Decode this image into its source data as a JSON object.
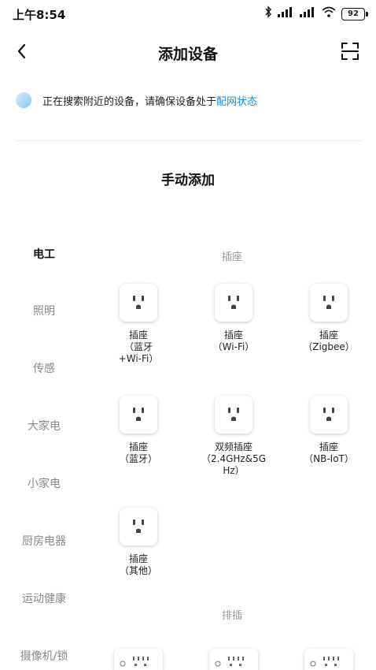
{
  "status_bar": {
    "time": "上午8:54",
    "bluetooth_icon": "bluetooth-icon",
    "signal_hd": "HD",
    "battery": "92"
  },
  "header": {
    "title": "添加设备",
    "back_icon": "chevron-left-icon",
    "scan_icon": "scan-icon"
  },
  "search_notice": {
    "text": "正在搜索附近的设备，请确保设备处于",
    "link": "配网状态"
  },
  "manual_title": "手动添加",
  "categories": [
    {
      "label": "电工",
      "active": true
    },
    {
      "label": "照明",
      "active": false
    },
    {
      "label": "传感",
      "active": false
    },
    {
      "label": "大家电",
      "active": false
    },
    {
      "label": "小家电",
      "active": false
    },
    {
      "label": "厨房电器",
      "active": false
    },
    {
      "label": "运动健康",
      "active": false
    },
    {
      "label": "摄像机/锁",
      "active": false
    }
  ],
  "groups": [
    {
      "title": "插座",
      "devices": [
        {
          "label": "插座\n（蓝牙\n+Wi-Fi）",
          "icon": "outlet-icon"
        },
        {
          "label": "插座\n（Wi-Fi）",
          "icon": "outlet-icon"
        },
        {
          "label": "插座\n（Zigbee）",
          "icon": "outlet-icon"
        },
        {
          "label": "插座\n（蓝牙）",
          "icon": "outlet-icon"
        },
        {
          "label": "双频插座\n（2.4GHz&5G\nHz）",
          "icon": "outlet-icon"
        },
        {
          "label": "插座\n（NB-IoT）",
          "icon": "outlet-icon"
        },
        {
          "label": "插座\n（其他）",
          "icon": "outlet-icon"
        }
      ]
    },
    {
      "title": "排插",
      "devices": [
        {
          "icon": "power-strip-icon"
        },
        {
          "icon": "power-strip-icon"
        },
        {
          "icon": "power-strip-icon"
        }
      ]
    }
  ]
}
